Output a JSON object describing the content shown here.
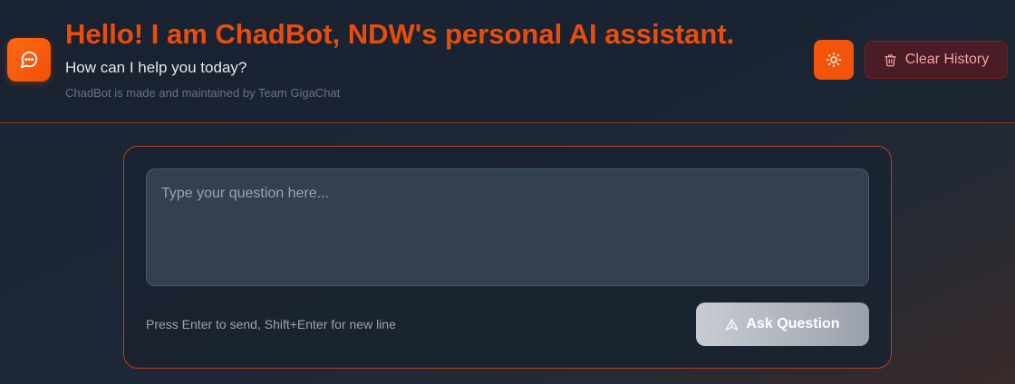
{
  "header": {
    "title": "Hello! I am ChadBot, NDW's personal AI assistant.",
    "subtitle": "How can I help you today?",
    "credit": "ChadBot is made and maintained by Team GigaChat",
    "logo_icon": "chat-bubble-icon",
    "theme_toggle_icon": "sun-icon",
    "clear_history": {
      "icon": "trash-icon",
      "label": "Clear History"
    }
  },
  "composer": {
    "input": {
      "value": "",
      "placeholder": "Type your question here..."
    },
    "hint": "Press Enter to send, Shift+Enter for new line",
    "ask_button": {
      "icon": "send-icon",
      "label": "Ask Question"
    }
  },
  "colors": {
    "accent": "#f3540b",
    "title": "#ea4d0b",
    "background": "#1b2433",
    "danger_bg": "#4a1c25",
    "danger_text": "#f2a3a3",
    "ask_button_start": "#c9ccd3",
    "ask_button_end": "#9aa0ab"
  }
}
